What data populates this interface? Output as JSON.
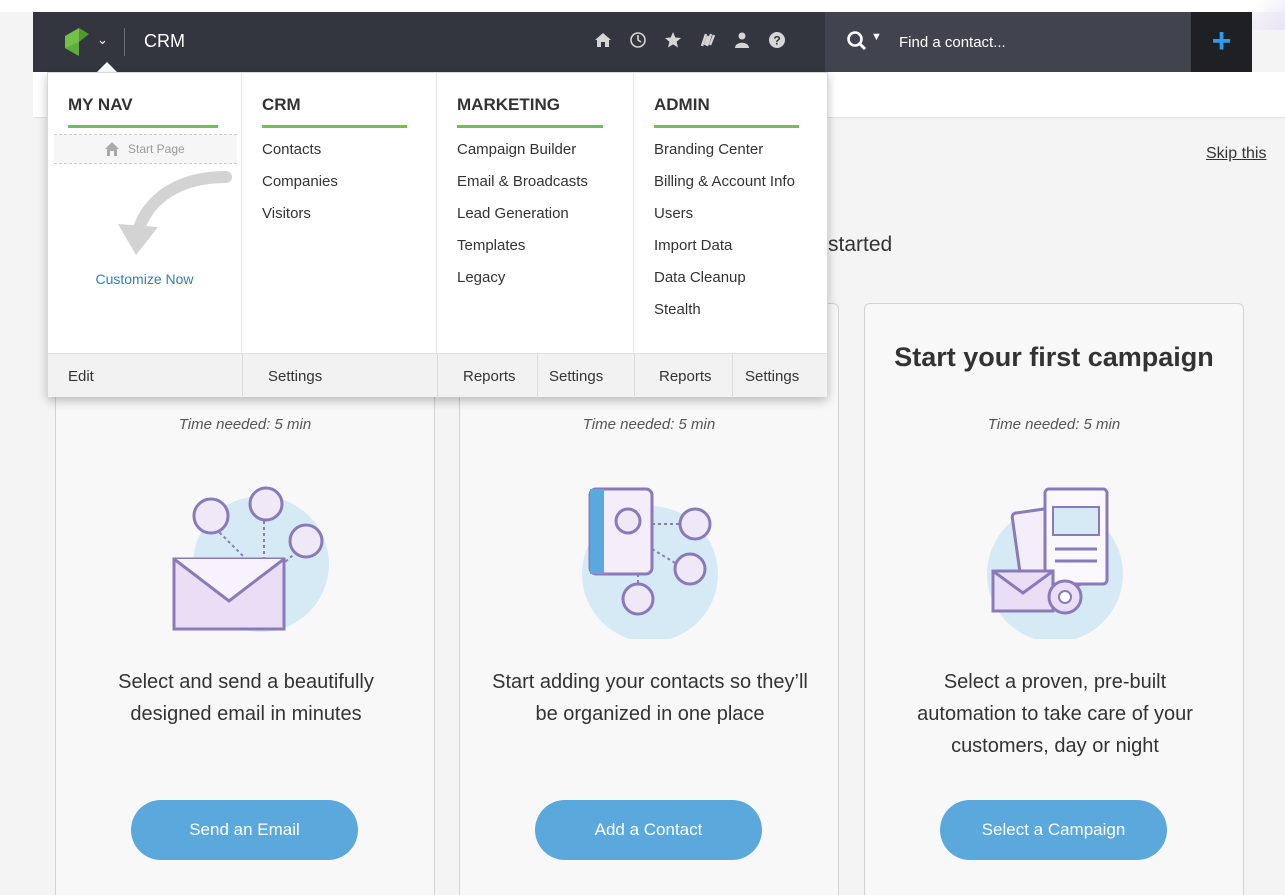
{
  "app": {
    "name": "CRM"
  },
  "header": {
    "icons": [
      "home-icon",
      "clock-icon",
      "star-icon",
      "flag-icon",
      "user-icon",
      "help-icon"
    ],
    "search": {
      "placeholder": "Find a contact..."
    },
    "add_label": "+"
  },
  "colors": {
    "nav_bg": "#33363f",
    "accent_green": "#74c04b",
    "button_blue": "#5aa8dc",
    "add_plus_blue": "#2d9bf0"
  },
  "page": {
    "skip_label": "Skip this",
    "started_text": "started"
  },
  "menu": {
    "columns": [
      {
        "heading": "MY NAV",
        "start_page": "Start Page",
        "customize": "Customize Now"
      },
      {
        "heading": "CRM",
        "items": [
          "Contacts",
          "Companies",
          "Visitors"
        ]
      },
      {
        "heading": "MARKETING",
        "items": [
          "Campaign Builder",
          "Email & Broadcasts",
          "Lead Generation",
          "Templates",
          "Legacy"
        ]
      },
      {
        "heading": "ADMIN",
        "items": [
          "Branding Center",
          "Billing & Account Info",
          "Users",
          "Import Data",
          "Data Cleanup",
          "Stealth"
        ]
      }
    ],
    "footer": {
      "mynav": [
        "Edit"
      ],
      "crm": [
        "Settings"
      ],
      "marketing": [
        "Reports",
        "Settings"
      ],
      "admin": [
        "Reports",
        "Settings"
      ]
    }
  },
  "cards": [
    {
      "title": "",
      "time": "Time needed: 5 min",
      "description": "Select and send a beautifully designed email in minutes",
      "button": "Send an Email"
    },
    {
      "title": "",
      "time": "Time needed: 5 min",
      "description": "Start adding your contacts so they’ll be organized in one place",
      "button": "Add a Contact"
    },
    {
      "title": "Start your first campaign",
      "time": "Time needed: 5 min",
      "description": "Select a proven, pre-built automation to take care of your customers, day or night",
      "button": "Select a Campaign"
    }
  ]
}
